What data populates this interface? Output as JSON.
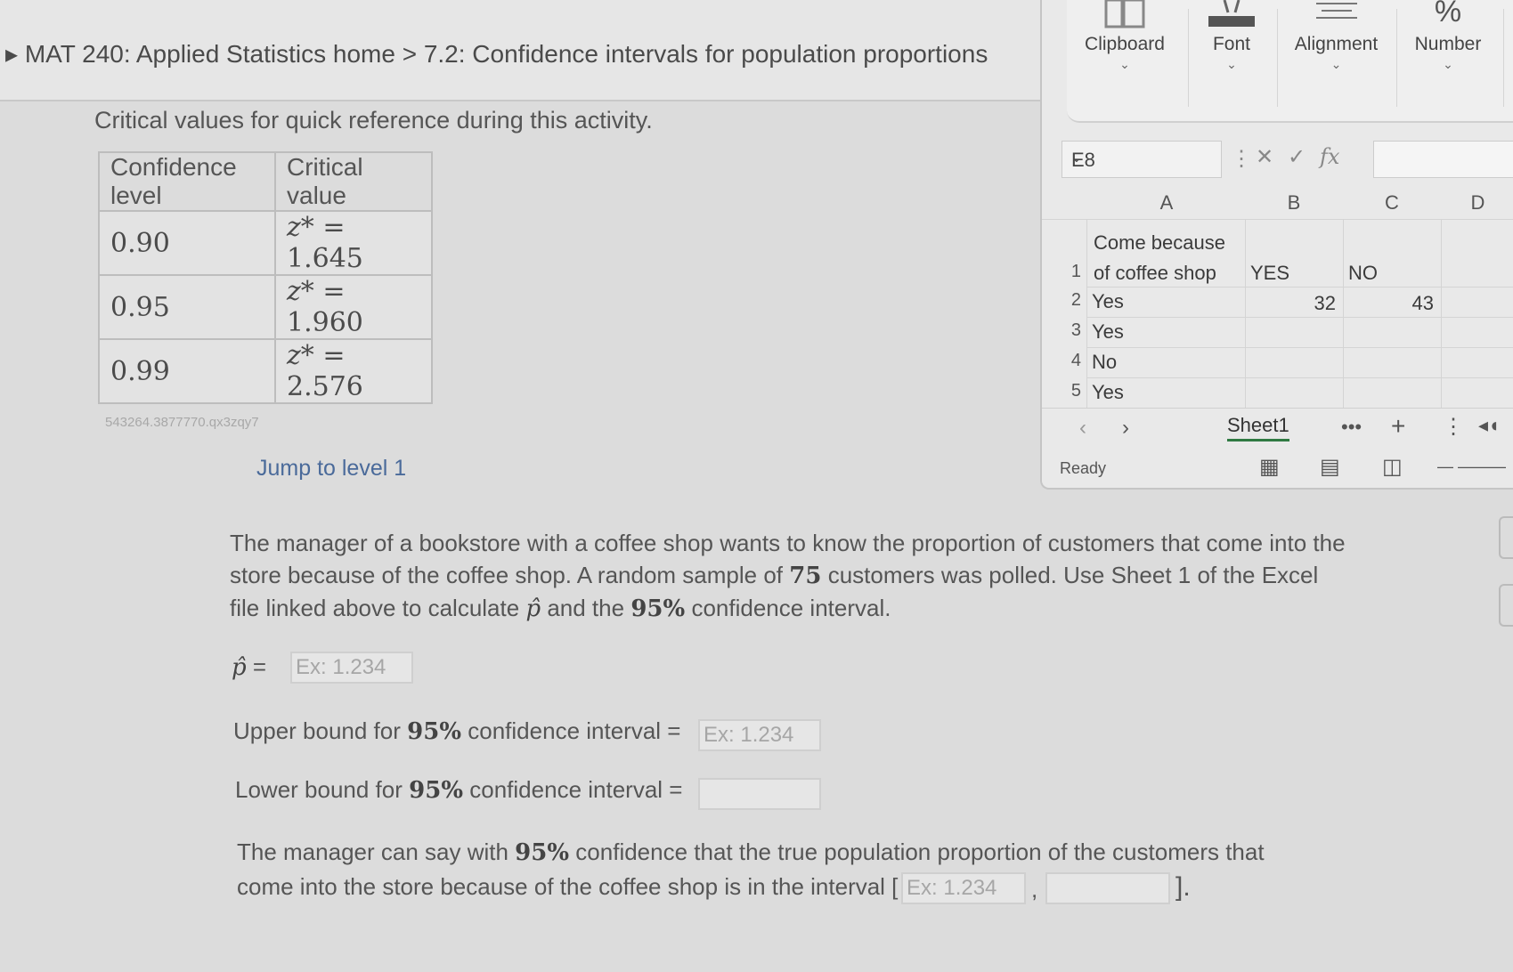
{
  "breadcrumb": {
    "course": "MAT 240: Applied Statistics home",
    "separator": ">",
    "section": "7.2: Confidence intervals for population proportions"
  },
  "critical_table": {
    "caption": "Critical values for quick reference during this activity.",
    "headers": [
      "Confidence level",
      "Critical value"
    ],
    "rows": [
      {
        "level": "0.90",
        "value": "1.645"
      },
      {
        "level": "0.95",
        "value": "1.960"
      },
      {
        "level": "0.99",
        "value": "2.576"
      }
    ],
    "zlabel": "z*",
    "equals": "="
  },
  "activity_id": "543264.3877770.qx3zqy7",
  "jump_link": "Jump to level 1",
  "excel": {
    "ribbon": [
      "Clipboard",
      "Font",
      "Alignment",
      "Number"
    ],
    "name_box": "E8",
    "fx": "fx",
    "columns": [
      "A",
      "B",
      "C",
      "D"
    ],
    "rows": [
      {
        "num": "1",
        "a_line1": "Come because",
        "a_line2": "of coffee shop",
        "b": "YES",
        "c": "NO"
      },
      {
        "num": "2",
        "a": "Yes",
        "b": "32",
        "c": "43"
      },
      {
        "num": "3",
        "a": "Yes"
      },
      {
        "num": "4",
        "a": "No"
      },
      {
        "num": "5",
        "a": "Yes"
      }
    ],
    "sheet_tab": "Sheet1",
    "status": "Ready"
  },
  "question": {
    "p1": "The manager of a bookstore with a coffee shop wants to know the proportion of customers that come into the store because of the coffee shop. A random sample of",
    "n": "75",
    "p2": "customers was polled. Use Sheet 1 of the Excel file linked above to calculate",
    "p3": "and the",
    "conf": "95%",
    "p4": "confidence interval.",
    "phat_symbol": "p̂",
    "eq": "=",
    "placeholder": "Ex: 1.234",
    "upper_prefix": "Upper bound for",
    "upper_suffix": "confidence interval =",
    "lower_prefix": "Lower bound for",
    "lower_suffix": "confidence interval =",
    "final1": "The manager can say with",
    "final2": "confidence that the true population proportion of the customers that come into the store because of the coffee shop is in the interval [",
    "comma": ",",
    "close": "]."
  }
}
